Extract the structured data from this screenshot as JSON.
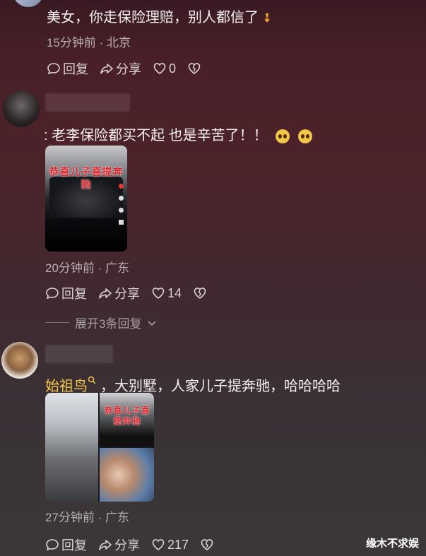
{
  "comments": [
    {
      "text": "美女，你走保险理赔，别人都信了",
      "time": "15分钟前",
      "location": "北京",
      "reply_label": "回复",
      "share_label": "分享",
      "likes": "0"
    },
    {
      "text": ": 老李保险都买不起 也是辛苦了！！",
      "image_caption": "恭喜儿子喜提奔驰",
      "time": "20分钟前",
      "location": "广东",
      "reply_label": "回复",
      "share_label": "分享",
      "likes": "14",
      "expand_label": "展开3条回复"
    },
    {
      "mention": "始祖鸟",
      "text": "，大别墅，人家儿子提奔驰，哈哈哈哈",
      "image_caption": "恭喜儿子喜提奔驰",
      "time": "27分钟前",
      "location": "广东",
      "reply_label": "回复",
      "share_label": "分享",
      "likes": "217"
    }
  ],
  "watermark": "缘木不求娱",
  "colors": {
    "accent_mention": "#f5c84a",
    "caption_red": "#e0262e"
  }
}
